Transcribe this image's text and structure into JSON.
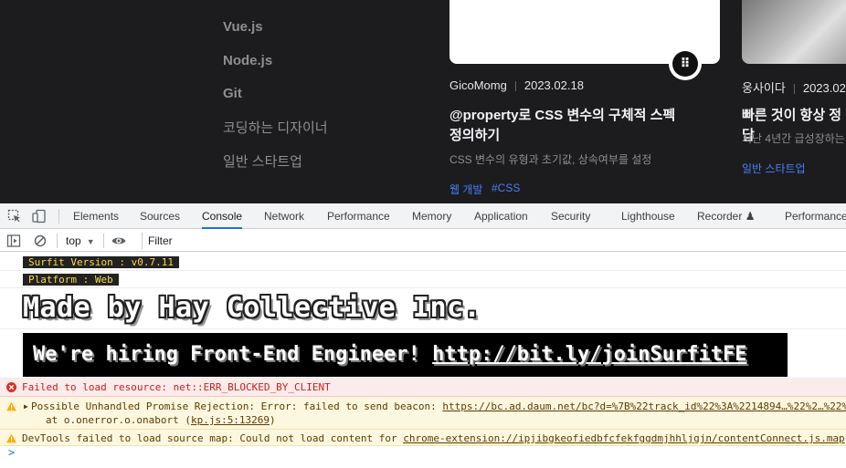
{
  "page": {
    "nav": [
      "Vue.js",
      "Node.js",
      "Git",
      "코딩하는 디자이너",
      "일반 스타트업"
    ],
    "cards": [
      {
        "author": "GicoMomg",
        "date": "2023.02.18",
        "title_line1": "@property로 CSS 변수의 구체적 스펙",
        "title_line2": "정의하기",
        "desc": "CSS 변수의 유형과 초기값, 상속여부를 설정",
        "tags": [
          "웹 개발",
          "#CSS"
        ]
      },
      {
        "author": "웅사이다",
        "date": "2023.02.",
        "title_line1": "빠른 것이 항상 정답",
        "desc": "지난 4년간 급성장하는",
        "tags": [
          "일반 스타트업"
        ]
      }
    ],
    "brand_badge_glyph": "⠿"
  },
  "devtools": {
    "tabs": [
      "Elements",
      "Sources",
      "Console",
      "Network",
      "Performance",
      "Memory",
      "Application",
      "Security",
      "Lighthouse",
      "Recorder ♟",
      "Performance"
    ],
    "active_tab": "Console",
    "context": "top",
    "filter_placeholder": "Filter",
    "console": {
      "version_badge": "Surfit Version : v0.7.11",
      "platform_badge": "Platform : Web",
      "made_by": "Made by Hay Collective Inc.",
      "hiring_text": "We're hiring Front-End Engineer! ",
      "hiring_link": "http://bit.ly/joinSurfitFE",
      "error_msg": "Failed to load resource: net::ERR_BLOCKED_BY_CLIENT",
      "warn1_msg": "Possible Unhandled Promise Rejection: Error: failed to send beacon: ",
      "warn1_link": "https://bc.ad.daum.net/bc?d=%7B%22track_id%22%3A%2214894…%22%2…%22%2C%",
      "warn1_line2_prefix": "at o.onerror.o.onabort (",
      "warn1_line2_link": "kp.js:5:13269",
      "warn1_line2_suffix": ")",
      "warn2_msg": "DevTools failed to load source map: Could not load content for ",
      "warn2_link": "chrome-extension://ipjibgkeofiedbfcfekfggdmjhhljgjn/contentConnect.js.map",
      "prompt": ">"
    }
  },
  "colors": {
    "accent": "#1a73e8",
    "tag": "#4a7cf7",
    "error": "#c5221f",
    "badge_text": "#ffd84a"
  }
}
